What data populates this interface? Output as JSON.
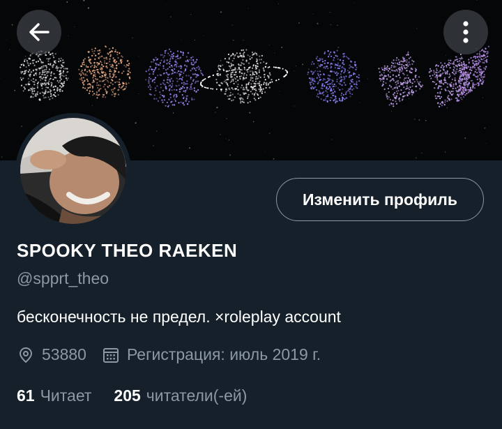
{
  "header": {
    "back_icon": "arrow-left-icon",
    "more_icon": "vertical-dots-icon",
    "banner_description": "drone light show shapes on night sky"
  },
  "profile": {
    "display_name": "SPOOKY THEO RAEKEN",
    "handle": "@spprt_theo",
    "bio": "бесконечность не предел. ×roleplay account",
    "location": "53880",
    "joined": "Регистрация: июль 2019 г.",
    "edit_button": "Изменить профиль"
  },
  "stats": {
    "following_count": "61",
    "following_label": "Читает",
    "followers_count": "205",
    "followers_label": "читатели(-ей)"
  },
  "colors": {
    "background": "#15202b",
    "secondary_text": "#8b98a5",
    "primary_text": "#ffffff"
  }
}
